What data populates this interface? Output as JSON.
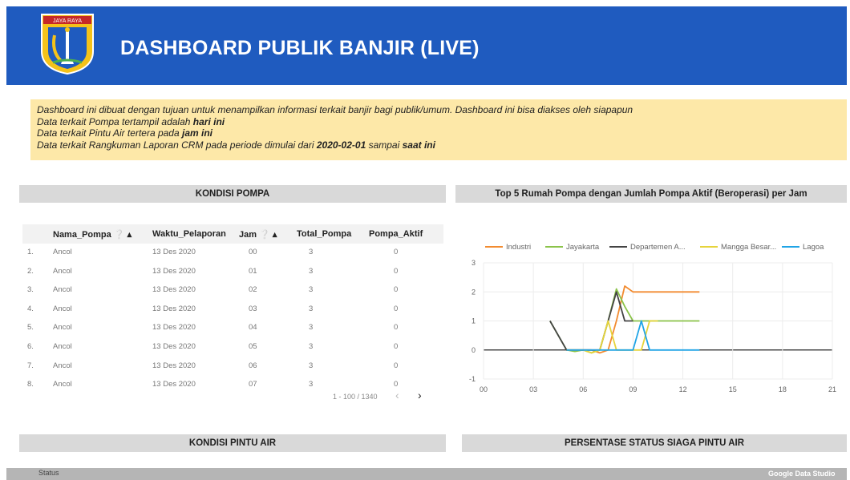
{
  "header": {
    "title": "DASHBOARD PUBLIK BANJIR (LIVE)",
    "logo_text": "JAYA RAYA"
  },
  "info": {
    "line1": "Dashboard ini dibuat dengan tujuan untuk menampilkan informasi terkait banjir bagi publik/umum. Dashboard ini bisa diakses oleh siapapun",
    "line2_prefix": "Data terkait Pompa tertampil adalah ",
    "line2_bold": "hari ini",
    "line3_prefix": "Data terkait Pintu Air tertera pada ",
    "line3_bold": "jam ini",
    "line4_prefix": "Data terkait Rangkuman Laporan CRM pada periode dimulai dari ",
    "line4_bold1": "2020-02-01",
    "line4_mid": " sampai ",
    "line4_bold2": "saat ini"
  },
  "sections": {
    "pompa": "KONDISI POMPA",
    "chart": "Top 5 Rumah Pompa dengan Jumlah Pompa Aktif (Beroperasi) per Jam",
    "pintu_air": "KONDISI PINTU AIR",
    "persentase": "PERSENTASE STATUS SIAGA PINTU AIR"
  },
  "table": {
    "columns": [
      "Nama_Pompa",
      "Waktu_Pelaporan",
      "Jam",
      "Total_Pompa",
      "Pompa_Aktif"
    ],
    "rows": [
      {
        "no": "1.",
        "nama": "Ancol",
        "waktu": "13 Des 2020",
        "jam": "00",
        "total": "3",
        "aktif": "0"
      },
      {
        "no": "2.",
        "nama": "Ancol",
        "waktu": "13 Des 2020",
        "jam": "01",
        "total": "3",
        "aktif": "0"
      },
      {
        "no": "3.",
        "nama": "Ancol",
        "waktu": "13 Des 2020",
        "jam": "02",
        "total": "3",
        "aktif": "0"
      },
      {
        "no": "4.",
        "nama": "Ancol",
        "waktu": "13 Des 2020",
        "jam": "03",
        "total": "3",
        "aktif": "0"
      },
      {
        "no": "5.",
        "nama": "Ancol",
        "waktu": "13 Des 2020",
        "jam": "04",
        "total": "3",
        "aktif": "0"
      },
      {
        "no": "6.",
        "nama": "Ancol",
        "waktu": "13 Des 2020",
        "jam": "05",
        "total": "3",
        "aktif": "0"
      },
      {
        "no": "7.",
        "nama": "Ancol",
        "waktu": "13 Des 2020",
        "jam": "06",
        "total": "3",
        "aktif": "0"
      },
      {
        "no": "8.",
        "nama": "Ancol",
        "waktu": "13 Des 2020",
        "jam": "07",
        "total": "3",
        "aktif": "0"
      }
    ],
    "pager": "1 - 100 / 1340"
  },
  "chart_data": {
    "type": "line",
    "title": "Top 5 Rumah Pompa dengan Jumlah Pompa Aktif (Beroperasi) per Jam",
    "xlim": [
      0,
      21
    ],
    "ylim": [
      -1,
      3
    ],
    "xticks": [
      "00",
      "03",
      "06",
      "09",
      "12",
      "15",
      "18",
      "21"
    ],
    "yticks": [
      "-1",
      "0",
      "1",
      "2",
      "3"
    ],
    "series": [
      {
        "name": "Industri",
        "color": "#f28b30",
        "x": [
          5,
          6,
          6.5,
          7,
          7.5,
          8,
          8.5,
          9,
          9.5,
          10,
          11,
          12,
          13
        ],
        "y": [
          0,
          0,
          0,
          -0.1,
          0,
          1,
          2.2,
          2,
          2,
          2,
          2,
          2,
          2
        ]
      },
      {
        "name": "Jayakarta",
        "color": "#8bc34a",
        "x": [
          4,
          4.5,
          5,
          5.5,
          6,
          6.5,
          7,
          7.5,
          8,
          8.5,
          9,
          9.5,
          10,
          11,
          12,
          13
        ],
        "y": [
          1,
          0.5,
          0,
          -0.05,
          0,
          -0.1,
          0,
          1,
          2.1,
          1.5,
          1,
          1,
          1,
          1,
          1,
          1
        ]
      },
      {
        "name": "Departemen A...",
        "color": "#444444",
        "x": [
          4,
          4.5,
          5,
          5.5,
          6,
          6.5,
          7,
          7.5,
          8,
          8.5,
          9
        ],
        "y": [
          1,
          0.5,
          0,
          0,
          0,
          0,
          0,
          1,
          2,
          1,
          1
        ]
      },
      {
        "name": "Mangga Besar...",
        "color": "#e6d43c",
        "x": [
          5,
          6,
          6.5,
          7,
          7.5,
          8,
          8.5,
          9,
          9.5,
          10,
          10.5
        ],
        "y": [
          0,
          0,
          -0.1,
          0,
          1,
          0,
          0,
          0,
          0,
          1,
          1
        ]
      },
      {
        "name": "Lagoa",
        "color": "#20a4e6",
        "x": [
          5,
          6,
          7,
          8,
          8.5,
          9,
          9.5,
          10,
          10.5,
          11,
          12,
          13
        ],
        "y": [
          0,
          0,
          0,
          0,
          0,
          0,
          1,
          0,
          0,
          0,
          0,
          0
        ]
      }
    ]
  },
  "footer": {
    "status_label": "Status",
    "brand": "Google Data Studio"
  }
}
